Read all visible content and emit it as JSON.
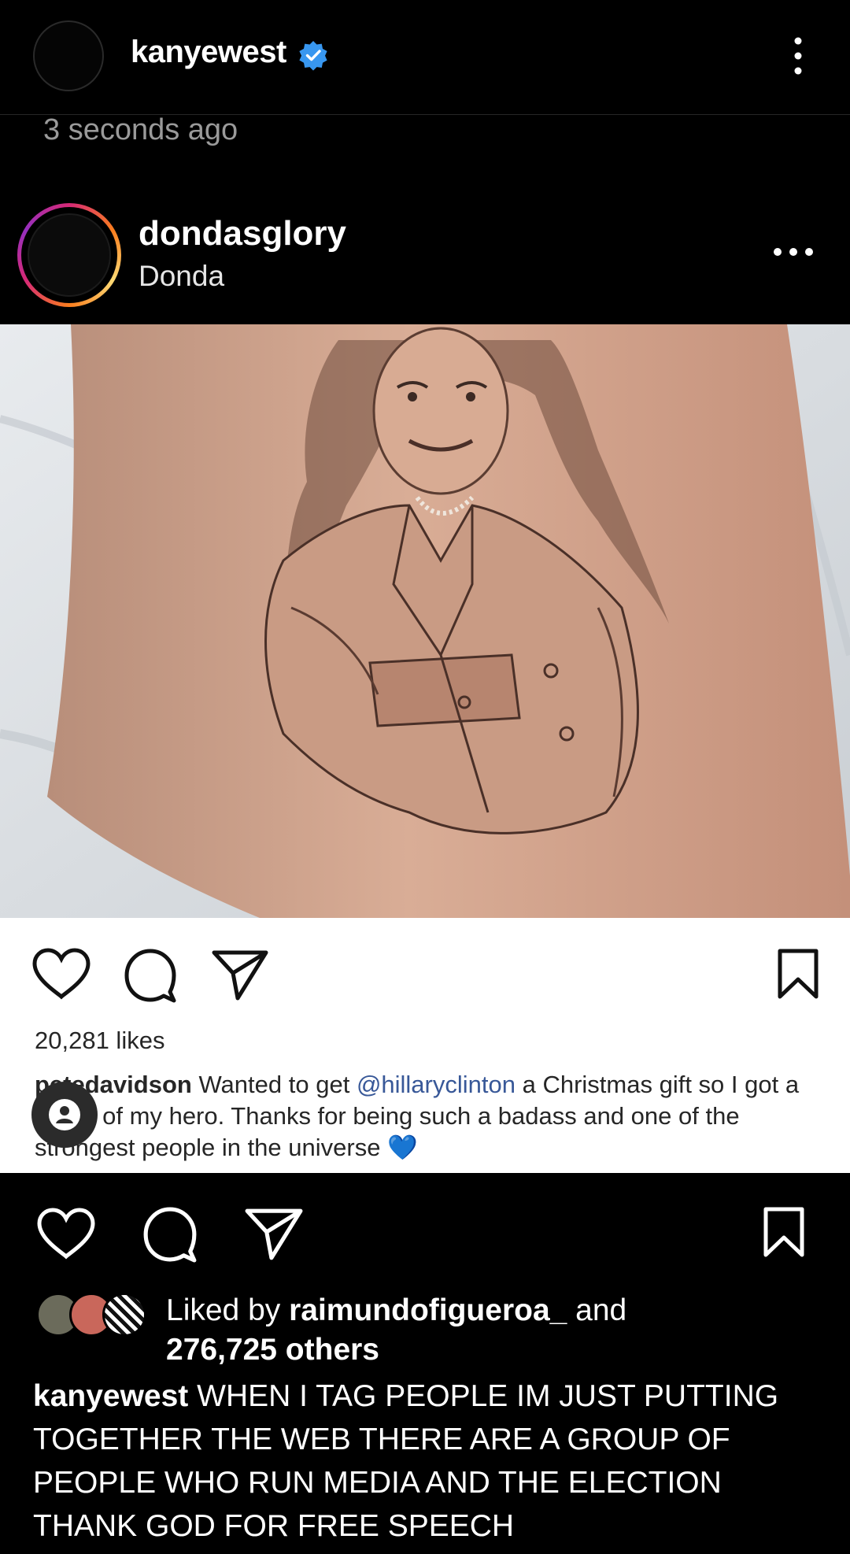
{
  "top_header": {
    "username": "kanyewest",
    "verified": true,
    "icons": {
      "verified": "verified-badge-icon",
      "more": "vertical-dots-icon"
    }
  },
  "timestamp": "3 seconds ago",
  "shared_post": {
    "username": "dondasglory",
    "subtitle": "Donda",
    "icons": {
      "more": "horizontal-dots-icon"
    },
    "image": "tattoo-portrait-photo"
  },
  "inner_post": {
    "likes": "20,281 likes",
    "caption_user": "petedavidson",
    "caption_text_1": "Wanted to get",
    "caption_mention": "@hillaryclinton",
    "caption_text_2": "a Christmas gift so I got a tattoo of my hero. Thanks for being such a badass and one of the strongest people in the universe",
    "caption_emoji": "💙"
  },
  "actions": {
    "icons": [
      "heart-icon",
      "comment-icon",
      "share-icon",
      "bookmark-icon"
    ]
  },
  "liked_by": {
    "prefix": "Liked by",
    "user": "raimundofigueroa_",
    "conjunction": "and",
    "others": "276,725 others"
  },
  "caption": {
    "user": "kanyewest",
    "text": "WHEN I TAG PEOPLE IM JUST PUTTING TOGETHER THE WEB  THERE ARE A GROUP OF PEOPLE WHO RUN MEDIA  AND THE ELECTION THANK GOD FOR FREE SPEECH"
  },
  "colors": {
    "background": "#000000",
    "verified_blue": "#3897f0",
    "mention_blue": "#385898",
    "secondary_text": "#9a9a9a"
  }
}
